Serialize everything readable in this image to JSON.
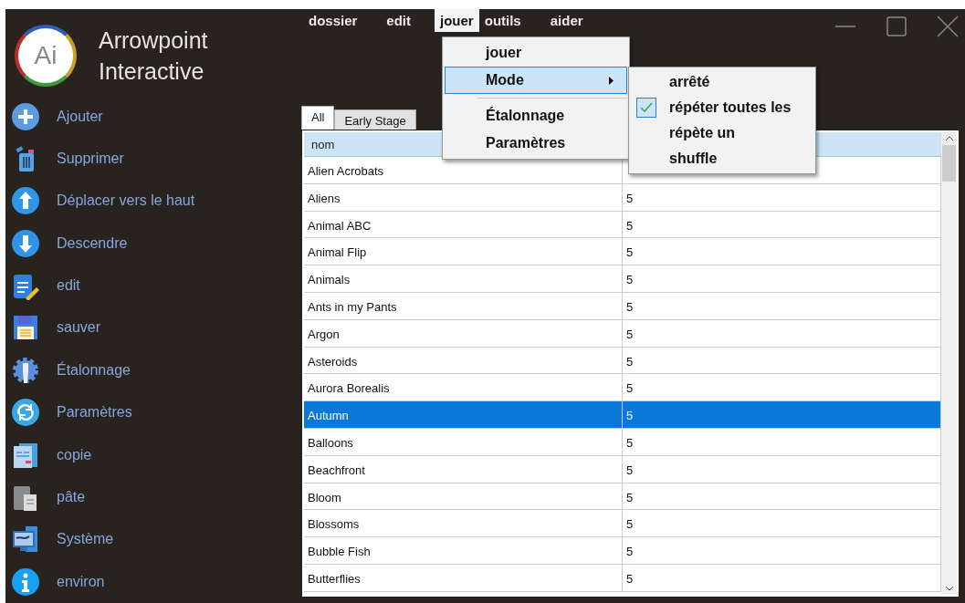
{
  "app": {
    "title_line_1": "Arrowpoint",
    "title_line_2": "Interactive",
    "logo": "Ai"
  },
  "sidebar": {
    "items": [
      {
        "label": "Ajouter"
      },
      {
        "label": "Supprimer"
      },
      {
        "label": "Déplacer vers le haut"
      },
      {
        "label": "Descendre"
      },
      {
        "label": "edit"
      },
      {
        "label": "sauver"
      },
      {
        "label": "Étalonnage"
      },
      {
        "label": "Paramètres"
      },
      {
        "label": "copie"
      },
      {
        "label": "pâte"
      },
      {
        "label": "Système"
      },
      {
        "label": "environ"
      }
    ]
  },
  "menu_bar": [
    {
      "label": "dossier",
      "selected": false
    },
    {
      "label": "edit",
      "selected": false
    },
    {
      "label": "jouer",
      "selected": true
    },
    {
      "label": "outils",
      "selected": false
    },
    {
      "label": "aider",
      "selected": false
    }
  ],
  "dropdown": {
    "items": [
      {
        "kind": "item",
        "label": "jouer",
        "selected": false
      },
      {
        "kind": "submenu",
        "label": "Mode",
        "selected": true
      },
      {
        "kind": "separator"
      },
      {
        "kind": "item",
        "label": "Étalonnage",
        "selected": false
      },
      {
        "kind": "item",
        "label": "Paramètres",
        "selected": false
      }
    ]
  },
  "submenu": {
    "items": [
      {
        "label": "arrêté",
        "checked": false
      },
      {
        "label": "répéter toutes les",
        "checked": true
      },
      {
        "label": "répète un",
        "checked": false
      },
      {
        "label": "shuffle",
        "checked": false
      }
    ]
  },
  "tabs": [
    {
      "label": "All",
      "selected": true
    },
    {
      "label": "Early Stage",
      "selected": false
    }
  ],
  "table": {
    "columns": [
      "nom"
    ],
    "rows": [
      {
        "name": "Alien Acrobats",
        "selected": false
      },
      {
        "name": "Aliens",
        "value": "5",
        "selected": false
      },
      {
        "name": "Animal ABC",
        "value": "5",
        "selected": false
      },
      {
        "name": "Animal Flip",
        "value": "5",
        "selected": false
      },
      {
        "name": "Animals",
        "value": "5",
        "selected": false
      },
      {
        "name": "Ants in my Pants",
        "value": "5",
        "selected": false
      },
      {
        "name": "Argon",
        "value": "5",
        "selected": false
      },
      {
        "name": "Asteroids",
        "value": "5",
        "selected": false
      },
      {
        "name": "Aurora Borealis",
        "value": "5",
        "selected": false
      },
      {
        "name": "Autumn",
        "value": "5",
        "selected": true
      },
      {
        "name": "Balloons",
        "value": "5",
        "selected": false
      },
      {
        "name": "Beachfront",
        "value": "5",
        "selected": false
      },
      {
        "name": "Bloom",
        "value": "5",
        "selected": false
      },
      {
        "name": "Blossoms",
        "value": "5",
        "selected": false
      },
      {
        "name": "Bubble Fish",
        "value": "5",
        "selected": false
      },
      {
        "name": "Butterflies",
        "value": "5",
        "selected": false
      }
    ]
  }
}
